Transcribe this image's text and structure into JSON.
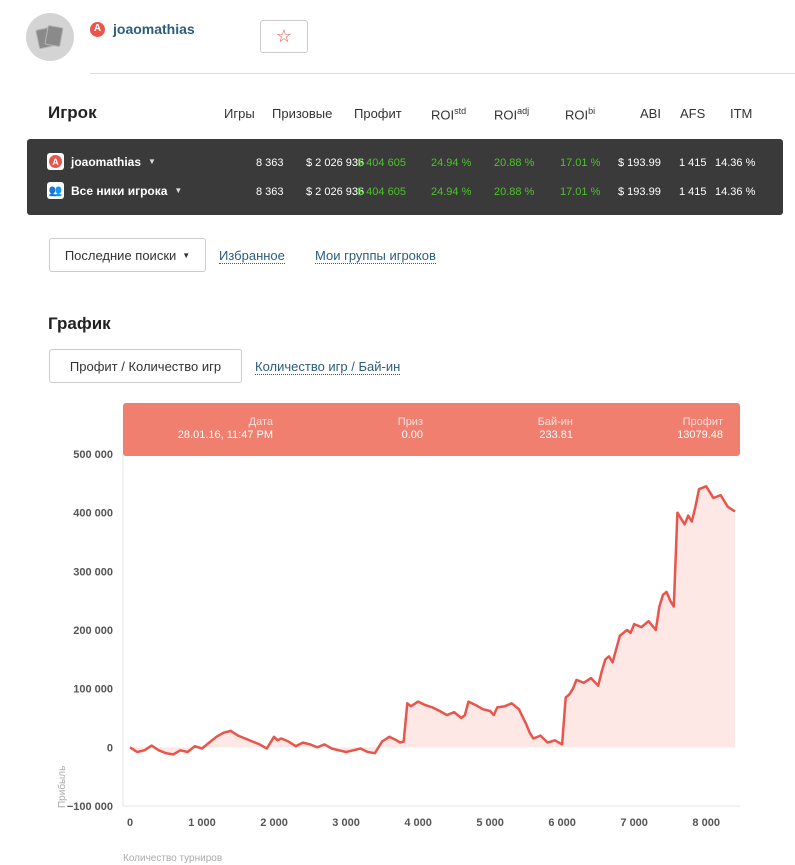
{
  "header": {
    "username": "joaomathias",
    "brand_icon": "A",
    "favorite_icon": "star-outline-icon"
  },
  "stats": {
    "title": "Игрок",
    "columns": {
      "games": "Игры",
      "prizes": "Призовые",
      "profit": "Профит",
      "roi_std": "ROI",
      "roi_std_sup": "std",
      "roi_adj": "ROI",
      "roi_adj_sup": "adj",
      "roi_bi": "ROI",
      "roi_bi_sup": "bi",
      "abi": "ABI",
      "afs": "AFS",
      "itm": "ITM"
    },
    "rows": [
      {
        "name": "joaomathias",
        "games": "8 363",
        "prizes": "$ 2 026 936",
        "profit": "$ 404 605",
        "roi_std": "24.94 %",
        "roi_adj": "20.88 %",
        "roi_bi": "17.01 %",
        "abi": "$ 193.99",
        "afs": "1 415",
        "itm": "14.36 %"
      },
      {
        "name": "Все ники игрока",
        "games": "8 363",
        "prizes": "$ 2 026 936",
        "profit": "$ 404 605",
        "roi_std": "24.94 %",
        "roi_adj": "20.88 %",
        "roi_bi": "17.01 %",
        "abi": "$ 193.99",
        "afs": "1 415",
        "itm": "14.36 %"
      }
    ]
  },
  "search_nav": {
    "recent": "Последние поиски",
    "favorites": "Избранное",
    "groups": "Мои группы игроков"
  },
  "chart_section": {
    "title": "График",
    "tab_active": "Профит / Количество игр",
    "tab_other": "Количество игр / Бай-ин"
  },
  "tooltip": {
    "date_label": "Дата",
    "date_value": "28.01.16, 11:47 PM",
    "prize_label": "Приз",
    "prize_value": "0.00",
    "buyin_label": "Бай-ин",
    "buyin_value": "233.81",
    "profit_label": "Профит",
    "profit_value": "13079.48"
  },
  "colors": {
    "accent": "#e9554b",
    "line": "#e9554b",
    "area": "#fde8e6",
    "green": "#4cc32c",
    "panel": "#3a3a3a",
    "link": "#2b5d7e"
  },
  "chart_data": {
    "type": "area",
    "xlabel": "Количество турниров",
    "ylabel": "Прибыль",
    "xlim": [
      0,
      8400
    ],
    "ylim": [
      -100000,
      500000
    ],
    "x_ticks": [
      "0",
      "1 000",
      "2 000",
      "3 000",
      "4 000",
      "5 000",
      "6 000",
      "7 000",
      "8 000"
    ],
    "y_ticks": [
      "500 000",
      "400 000",
      "300 000",
      "200 000",
      "100 000",
      "0",
      "−100 000"
    ],
    "x_tick_values": [
      0,
      1000,
      2000,
      3000,
      4000,
      5000,
      6000,
      7000,
      8000
    ],
    "y_tick_values": [
      500000,
      400000,
      300000,
      200000,
      100000,
      0,
      -100000
    ],
    "series": [
      {
        "x": [
          0,
          100,
          200,
          300,
          400,
          500,
          600,
          700,
          800,
          900,
          1000,
          1100,
          1200,
          1300,
          1400,
          1500,
          1600,
          1700,
          1800,
          1900,
          2000,
          2050,
          2100,
          2200,
          2300,
          2400,
          2500,
          2600,
          2700,
          2800,
          2900,
          3000,
          3100,
          3200,
          3300,
          3400,
          3450,
          3500,
          3600,
          3700,
          3750,
          3800,
          3850,
          3900,
          4000,
          4100,
          4200,
          4300,
          4400,
          4500,
          4600,
          4650,
          4700,
          4800,
          4900,
          5000,
          5050,
          5100,
          5200,
          5300,
          5400,
          5500,
          5550,
          5600,
          5700,
          5800,
          5900,
          6000,
          6050,
          6100,
          6150,
          6200,
          6300,
          6400,
          6500,
          6550,
          6600,
          6650,
          6700,
          6800,
          6900,
          6950,
          7000,
          7100,
          7200,
          7300,
          7350,
          7400,
          7450,
          7500,
          7550,
          7600,
          7700,
          7750,
          7800,
          7850,
          7900,
          8000,
          8100,
          8200,
          8300,
          8400
        ],
        "y": [
          0,
          -8000,
          -5000,
          3000,
          -5000,
          -10000,
          -12000,
          -5000,
          -8000,
          2000,
          -2000,
          8000,
          18000,
          25000,
          28000,
          20000,
          15000,
          10000,
          5000,
          -2000,
          18000,
          12000,
          15000,
          10000,
          2000,
          8000,
          5000,
          0,
          5000,
          -2000,
          -5000,
          -8000,
          -5000,
          -2000,
          -8000,
          -10000,
          0,
          10000,
          18000,
          12000,
          8000,
          10000,
          75000,
          70000,
          78000,
          72000,
          68000,
          62000,
          55000,
          60000,
          50000,
          55000,
          78000,
          72000,
          65000,
          62000,
          55000,
          68000,
          70000,
          75000,
          65000,
          40000,
          25000,
          15000,
          20000,
          8000,
          12000,
          5000,
          85000,
          90000,
          100000,
          115000,
          110000,
          118000,
          105000,
          130000,
          150000,
          155000,
          145000,
          190000,
          200000,
          195000,
          210000,
          205000,
          215000,
          200000,
          240000,
          260000,
          265000,
          250000,
          240000,
          400000,
          380000,
          395000,
          385000,
          410000,
          440000,
          445000,
          425000,
          430000,
          410000,
          402000
        ]
      }
    ],
    "grid": false
  }
}
